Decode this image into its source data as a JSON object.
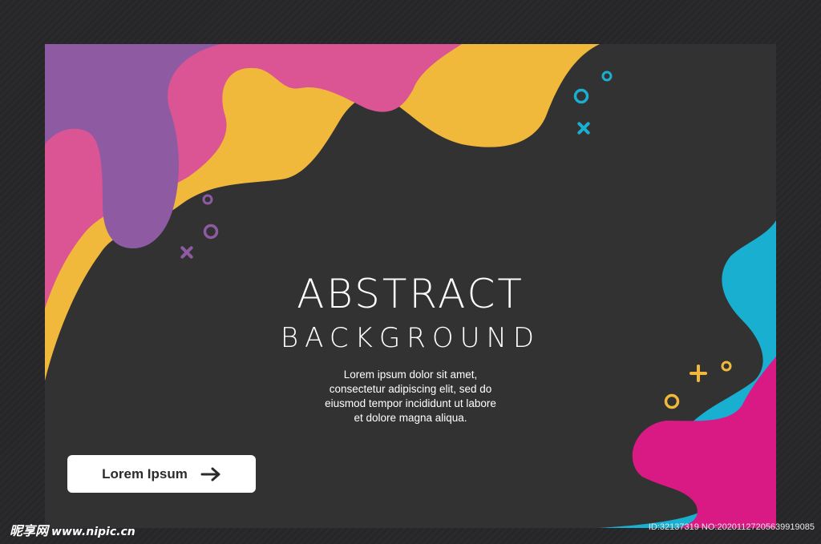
{
  "hero": {
    "title_line1": "ABSTRACT",
    "title_line2": "BACKGROUND",
    "description_lines": [
      "Lorem ipsum dolor sit amet,",
      "consectetur adipiscing elit, sed do",
      "eiusmod tempor incididunt ut labore",
      "et dolore magna aliqua."
    ]
  },
  "cta": {
    "label": "Lorem Ipsum",
    "icon": "arrow-right-icon"
  },
  "watermark": {
    "logo_text": "昵享网",
    "url": "www.nipic.cn",
    "id_text": "ID:32137319 NO:20201127205639919085"
  },
  "colors": {
    "background": "#333233",
    "purple": "#8e5ba3",
    "pink": "#db5494",
    "yellow": "#f0b93b",
    "cyan": "#18afd0",
    "magenta": "#d91a84",
    "button": "#ffffff"
  }
}
